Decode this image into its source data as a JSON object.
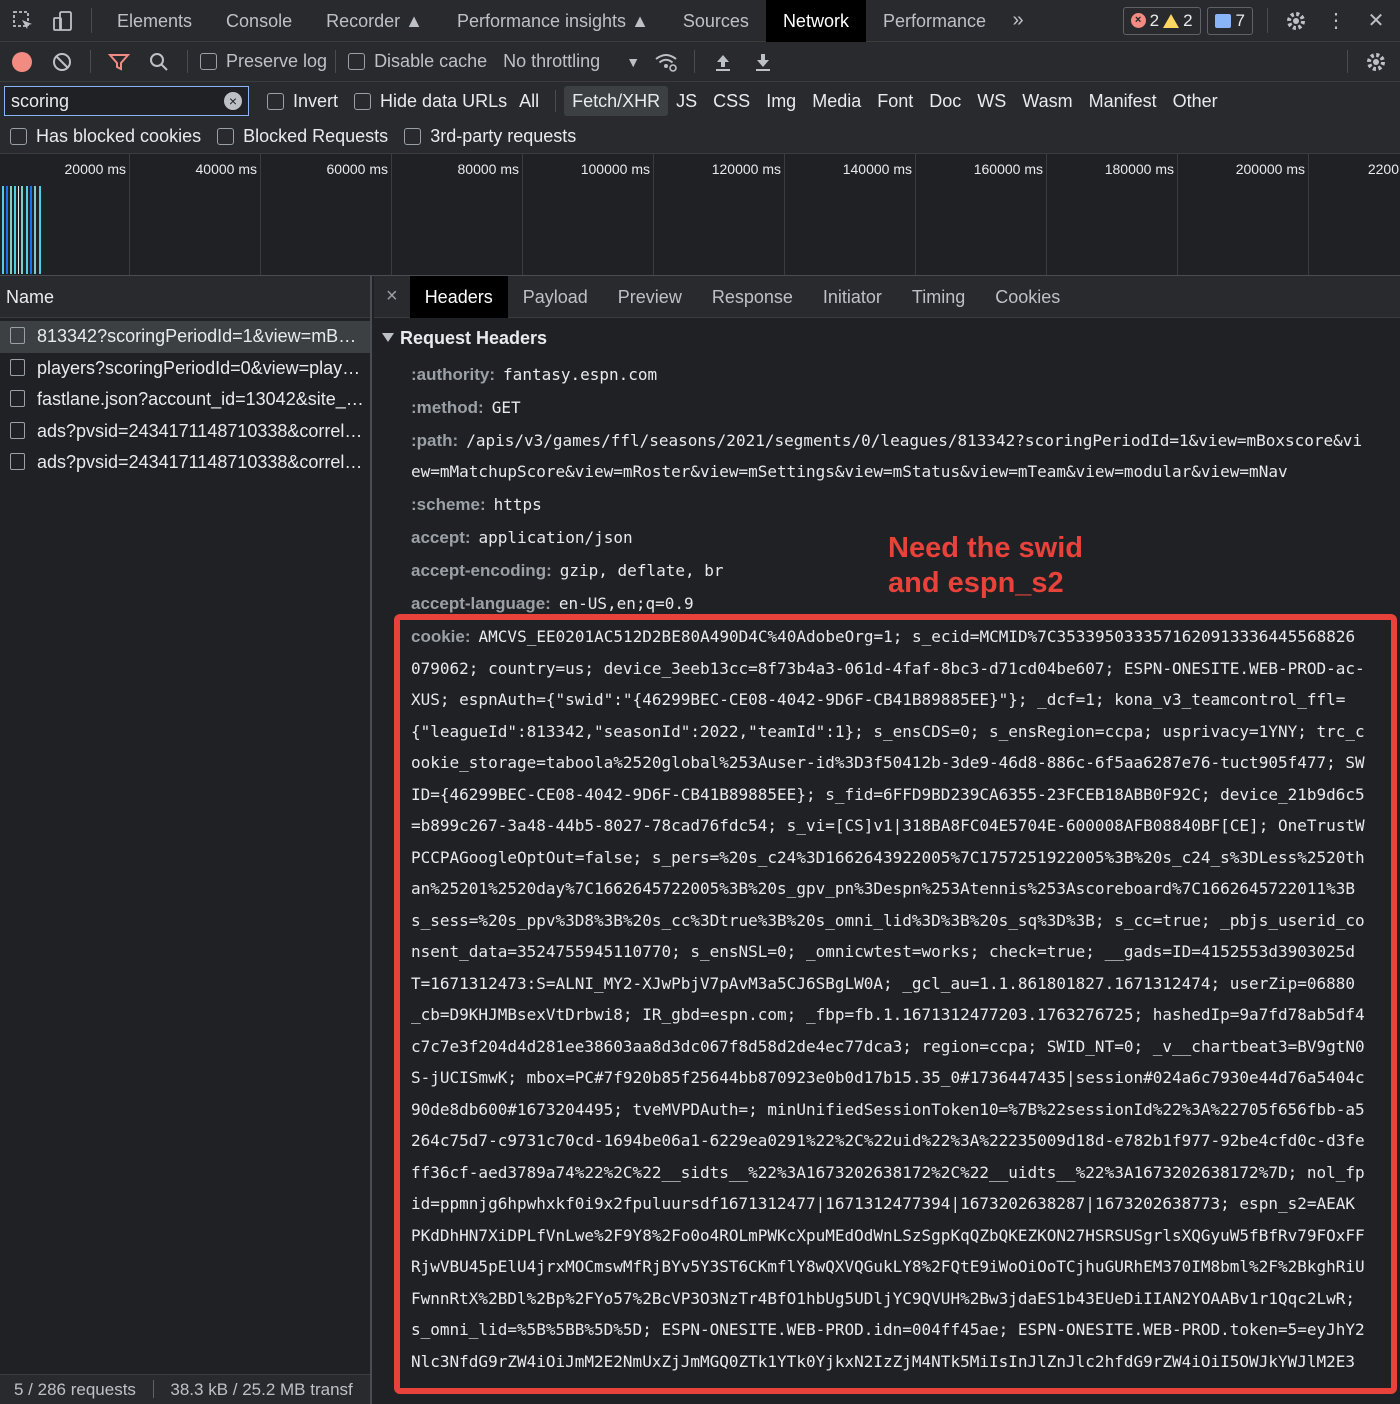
{
  "tabbar": {
    "tabs": [
      "Elements",
      "Console",
      "Recorder",
      "Performance insights",
      "Sources",
      "Network",
      "Performance"
    ],
    "active": "Network",
    "errors": "2",
    "warnings": "2",
    "messages": "7"
  },
  "toolbar": {
    "preserve_log": "Preserve log",
    "disable_cache": "Disable cache",
    "throttling": "No throttling"
  },
  "filter": {
    "search_value": "scoring",
    "invert": "Invert",
    "hide_data_urls": "Hide data URLs",
    "types": [
      "All",
      "Fetch/XHR",
      "JS",
      "CSS",
      "Img",
      "Media",
      "Font",
      "Doc",
      "WS",
      "Wasm",
      "Manifest",
      "Other"
    ],
    "active_type": "Fetch/XHR",
    "has_blocked_cookies": "Has blocked cookies",
    "blocked_requests": "Blocked Requests",
    "third_party": "3rd-party requests"
  },
  "overview": {
    "ticks": [
      "20000 ms",
      "40000 ms",
      "60000 ms",
      "80000 ms",
      "100000 ms",
      "120000 ms",
      "140000 ms",
      "160000 ms",
      "180000 ms",
      "200000 ms",
      "2200"
    ]
  },
  "requests": {
    "header": "Name",
    "rows": [
      "813342?scoringPeriodId=1&view=mB…",
      "players?scoringPeriodId=0&view=play…",
      "fastlane.json?account_id=13042&site_…",
      "ads?pvsid=2434171148710338&correl…",
      "ads?pvsid=2434171148710338&correl…"
    ],
    "status": "5 / 286 requests",
    "transfer": "38.3 kB / 25.2 MB transf"
  },
  "details": {
    "tabs": [
      "Headers",
      "Payload",
      "Preview",
      "Response",
      "Initiator",
      "Timing",
      "Cookies"
    ],
    "active_tab": "Headers",
    "section": "Request Headers",
    "headers": [
      {
        "k": ":authority:",
        "v": "fantasy.espn.com"
      },
      {
        "k": ":method:",
        "v": "GET"
      },
      {
        "k": ":path:",
        "v": "/apis/v3/games/ffl/seasons/2021/segments/0/leagues/813342?scoringPeriodId=1&view=mBoxscore&vi"
      },
      {
        "k": "",
        "v": "ew=mMatchupScore&view=mRoster&view=mSettings&view=mStatus&view=mTeam&view=modular&view=mNav"
      },
      {
        "k": ":scheme:",
        "v": "https"
      },
      {
        "k": "accept:",
        "v": "application/json"
      },
      {
        "k": "accept-encoding:",
        "v": "gzip, deflate, br"
      },
      {
        "k": "accept-language:",
        "v": "en-US,en;q=0.9"
      }
    ],
    "cookie_key": "cookie:",
    "cookie_lines": [
      "AMCVS_EE0201AC512D2BE80A490D4C%40AdobeOrg=1; s_ecid=MCMID%7C3533950333571620913336445568826",
      "079062; country=us; device_3eeb13cc=8f73b4a3-061d-4faf-8bc3-d71cd04be607; ESPN-ONESITE.WEB-PROD-ac-",
      "XUS; espnAuth={\"swid\":\"{46299BEC-CE08-4042-9D6F-CB41B89885EE}\"}; _dcf=1; kona_v3_teamcontrol_ffl=",
      "{\"leagueId\":813342,\"seasonId\":2022,\"teamId\":1}; s_ensCDS=0; s_ensRegion=ccpa; usprivacy=1YNY; trc_c",
      "ookie_storage=taboola%2520global%253Auser-id%3D3f50412b-3de9-46d8-886c-6f5aa6287e76-tuct905f477; SW",
      "ID={46299BEC-CE08-4042-9D6F-CB41B89885EE}; s_fid=6FFD9BD239CA6355-23FCEB18ABB0F92C; device_21b9d6c5",
      "=b899c267-3a48-44b5-8027-78cad76fdc54; s_vi=[CS]v1|318BA8FC04E5704E-600008AFB08840BF[CE]; OneTrustW",
      "PCCPAGoogleOptOut=false; s_pers=%20s_c24%3D1662643922005%7C1757251922005%3B%20s_c24_s%3DLess%2520th",
      "an%25201%2520day%7C1662645722005%3B%20s_gpv_pn%3Despn%253Atennis%253Ascoreboard%7C1662645722011%3B",
      "s_sess=%20s_ppv%3D8%3B%20s_cc%3Dtrue%3B%20s_omni_lid%3D%3B%20s_sq%3D%3B; s_cc=true; _pbjs_userid_co",
      "nsent_data=3524755945110770; s_ensNSL=0; _omnicwtest=works; check=true; __gads=ID=4152553d3903025d",
      "T=1671312473:S=ALNI_MY2-XJwPbjV7pAvM3a5CJ6SBgLW0A; _gcl_au=1.1.861801827.1671312474; userZip=06880",
      "_cb=D9KHJMBsexVtDrbwi8; IR_gbd=espn.com; _fbp=fb.1.1671312477203.1763276725; hashedIp=9a7fd78ab5df4",
      "c7c7e3f204d4d281ee38603aa8d3dc067f8d58d2de4ec77dca3; region=ccpa; SWID_NT=0; _v__chartbeat3=BV9gtN0",
      "S-jUCISmwK; mbox=PC#7f920b85f25644bb870923e0b0d17b15.35_0#1736447435|session#024a6c7930e44d76a5404c",
      "90de8db600#1673204495; tveMVPDAuth=; minUnifiedSessionToken10=%7B%22sessionId%22%3A%22705f656fbb-a5",
      "264c75d7-c9731c70cd-1694be06a1-6229ea0291%22%2C%22uid%22%3A%22235009d18d-e782b1f977-92be4cfd0c-d3fe",
      "ff36cf-aed3789a74%22%2C%22__sidts__%22%3A1673202638172%2C%22__uidts__%22%3A1673202638172%7D; nol_fp",
      "id=ppmnjg6hpwhxkf0i9x2fpuluursdf1671312477|1671312477394|1673202638287|1673202638773; espn_s2=AEAK",
      "PKdDhHN7XiDPLfVnLwe%2F9Y8%2Fo0o4ROLmPWKcXpuMEdOdWnLSzSgpKqQZbQKEZKON27HSRSUSgrlsXQGyuW5fBfRv79FOxFF",
      "RjwVBU45pElU4jrxMOCmswMfRjBYv5Y3ST6CKmflY8wQXVQGukLY8%2FQtE9iWoOiOoTCjhuGURhEM370IM8bml%2F%2BkghRiU",
      "FwnnRtX%2BDl%2Bp%2FYo57%2BcVP3O3NzTr4BfO1hbUg5UDljYC9QVUH%2Bw3jdaES1b43EUeDiIIAN2YOAABv1r1Qqc2LwR;",
      "s_omni_lid=%5B%5BB%5D%5D; ESPN-ONESITE.WEB-PROD.idn=004ff45ae; ESPN-ONESITE.WEB-PROD.token=5=eyJhY2",
      "Nlc3NfdG9rZW4iOiJmM2E2NmUxZjJmMGQ0ZTk1YTk0YjkxN2IzZjM4NTk5MiIsInJlZnJlc2hfdG9rZW4iOiI5OWJkYWJlM2E3"
    ],
    "annotation_line1": "Need the swid",
    "annotation_line2": "and espn_s2"
  },
  "colors": {
    "accent": "#8ab4f8",
    "annotation": "#e8423a",
    "record": "#f28b82"
  }
}
